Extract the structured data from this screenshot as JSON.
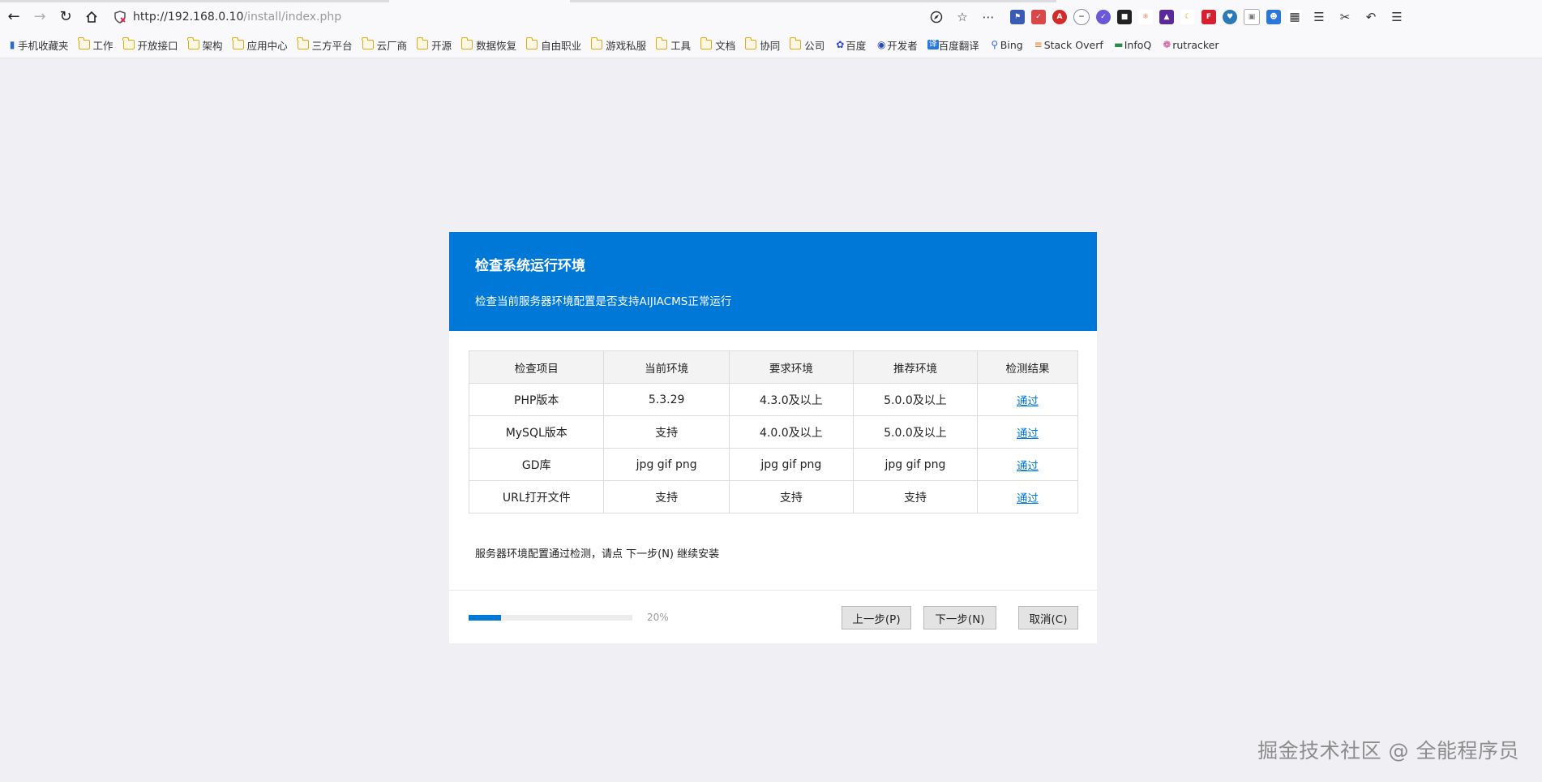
{
  "browser": {
    "url_host": "http://192.168.0.10",
    "url_path": "/install/index.php"
  },
  "bookmarks": [
    {
      "label": "手机收藏夹",
      "icon": "mobile-icon"
    },
    {
      "label": "工作",
      "icon": "folder-icon"
    },
    {
      "label": "开放接口",
      "icon": "folder-icon"
    },
    {
      "label": "架构",
      "icon": "folder-icon"
    },
    {
      "label": "应用中心",
      "icon": "folder-icon"
    },
    {
      "label": "三方平台",
      "icon": "folder-icon"
    },
    {
      "label": "云厂商",
      "icon": "folder-icon"
    },
    {
      "label": "开源",
      "icon": "folder-icon"
    },
    {
      "label": "数据恢复",
      "icon": "folder-icon"
    },
    {
      "label": "自由职业",
      "icon": "folder-icon"
    },
    {
      "label": "游戏私服",
      "icon": "folder-icon"
    },
    {
      "label": "工具",
      "icon": "folder-icon"
    },
    {
      "label": "文档",
      "icon": "folder-icon"
    },
    {
      "label": "协同",
      "icon": "folder-icon"
    },
    {
      "label": "公司",
      "icon": "folder-icon"
    },
    {
      "label": "百度",
      "icon": "baidu-icon"
    },
    {
      "label": "开发者",
      "icon": "dev-icon"
    },
    {
      "label": "百度翻译",
      "icon": "translate-icon"
    },
    {
      "label": "Bing",
      "icon": "search-icon"
    },
    {
      "label": "Stack Overf",
      "icon": "stackoverflow-icon"
    },
    {
      "label": "InfoQ",
      "icon": "infoq-icon"
    },
    {
      "label": "rutracker",
      "icon": "rutracker-icon"
    }
  ],
  "installer": {
    "title": "检查系统运行环境",
    "subtitle": "检查当前服务器环境配置是否支持AIJIACMS正常运行",
    "table": {
      "headers": [
        "检查项目",
        "当前环境",
        "要求环境",
        "推荐环境",
        "检测结果"
      ],
      "rows": [
        [
          "PHP版本",
          "5.3.29",
          "4.3.0及以上",
          "5.0.0及以上",
          "通过"
        ],
        [
          "MySQL版本",
          "支持",
          "4.0.0及以上",
          "5.0.0及以上",
          "通过"
        ],
        [
          "GD库",
          "jpg gif png",
          "jpg gif png",
          "jpg gif png",
          "通过"
        ],
        [
          "URL打开文件",
          "支持",
          "支持",
          "支持",
          "通过"
        ]
      ]
    },
    "status_message": "服务器环境配置通过检测，请点 下一步(N) 继续安装",
    "progress_percent": 20,
    "progress_label": "20%",
    "buttons": {
      "prev": "上一步(P)",
      "next": "下一步(N)",
      "cancel": "取消(C)"
    },
    "accent_color": "#0078d7"
  },
  "watermark": "掘金技术社区 @ 全能程序员"
}
